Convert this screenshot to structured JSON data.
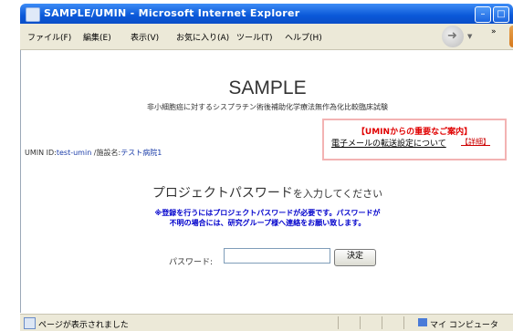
{
  "window": {
    "title": "SAMPLE/UMIN - Microsoft Internet Explorer",
    "min_glyph": "–",
    "max_glyph": "□"
  },
  "menu": {
    "file": "ファイル(F)",
    "edit": "編集(E)",
    "view": "表示(V)",
    "favorites": "お気に入り(A)",
    "tools": "ツール(T)",
    "help": "ヘルプ(H)",
    "overflow": "»"
  },
  "page": {
    "title": "SAMPLE",
    "subtitle": "非小細胞癌に対するシスプラチン術後補助化学療法無作為化比較臨床試験",
    "notice_head": "【UMINからの重要なご案内】",
    "notice_link": "電子メールの転送設定について",
    "notice_detail": "【詳細】",
    "umin_label": "UMIN ID:",
    "umin_id": "test-umin",
    "facility_label": " /施設名:",
    "facility": "テスト病院1",
    "heading_main": "プロジェクトパスワード",
    "heading_rest": "を入力してください",
    "note_line1": "※登録を行うにはプロジェクトパスワードが必要です。パスワードが",
    "note_line2": "不明の場合には、研究グループ様へ連絡をお願い致します。",
    "password_label": "パスワード:",
    "password_value": "",
    "submit_label": "決定"
  },
  "status": {
    "text": "ページが表示されました",
    "zone": "マイ コンピュータ"
  }
}
